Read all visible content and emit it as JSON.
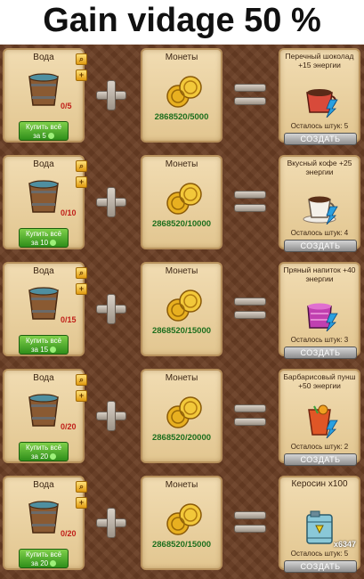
{
  "page_title": "Gain vidage 50 %",
  "colors": {
    "board": "#6b3f25",
    "card": "#e9d3a3",
    "buy_button": "#3aa01f",
    "create_button": "#9a9a9a",
    "coin_text": "#1d6e1d",
    "count_text": "#c0201a"
  },
  "recipes": [
    {
      "ingredient": {
        "label": "Вода",
        "count": "0/5",
        "buy_line1": "Купить всё",
        "buy_line2": "за 5"
      },
      "coins": {
        "label": "Монеты",
        "value": "2868520/5000"
      },
      "result": {
        "label": "Перечный шоколад +15 энергии",
        "remaining": "Осталось штук: 5",
        "create": "СОЗДАТЬ",
        "icon": "chocolate-cup-icon"
      }
    },
    {
      "ingredient": {
        "label": "Вода",
        "count": "0/10",
        "buy_line1": "Купить всё",
        "buy_line2": "за 10"
      },
      "coins": {
        "label": "Монеты",
        "value": "2868520/10000"
      },
      "result": {
        "label": "Вкусный кофе +25 энергии",
        "remaining": "Осталось штук: 4",
        "create": "СОЗДАТЬ",
        "icon": "coffee-cup-icon"
      }
    },
    {
      "ingredient": {
        "label": "Вода",
        "count": "0/15",
        "buy_line1": "Купить всё",
        "buy_line2": "за 15"
      },
      "coins": {
        "label": "Монеты",
        "value": "2868520/15000"
      },
      "result": {
        "label": "Пряный напиток +40 энергии",
        "remaining": "Осталось штук: 3",
        "create": "СОЗДАТЬ",
        "icon": "spiced-drink-icon"
      }
    },
    {
      "ingredient": {
        "label": "Вода",
        "count": "0/20",
        "buy_line1": "Купить всё",
        "buy_line2": "за 20"
      },
      "coins": {
        "label": "Монеты",
        "value": "2868520/20000"
      },
      "result": {
        "label": "Барбарисовый пунш +50 энергии",
        "remaining": "Осталось штук: 2",
        "create": "СОЗДАТЬ",
        "icon": "punch-glass-icon"
      }
    },
    {
      "ingredient": {
        "label": "Вода",
        "count": "0/20",
        "buy_line1": "Купить всё",
        "buy_line2": "за 20"
      },
      "coins": {
        "label": "Монеты",
        "value": "2868520/15000"
      },
      "result": {
        "label": "Керосин x100",
        "remaining": "Осталось штук: 5",
        "create": "СОЗДАТЬ",
        "icon": "kerosene-canister-icon",
        "stock": "x6347"
      }
    }
  ]
}
